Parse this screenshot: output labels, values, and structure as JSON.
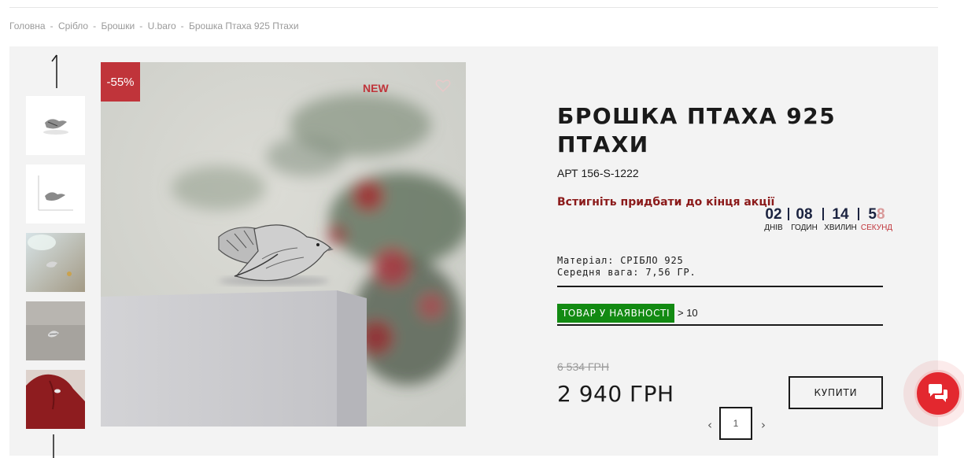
{
  "breadcrumb": [
    "Головна",
    "Срібло",
    "Брошки",
    "U.baro",
    "Брошка Птаха 925 Птахи"
  ],
  "breadcrumb_separator": "-",
  "badges": {
    "discount": "-55%",
    "new": "NEW"
  },
  "product": {
    "title": "БРОШКА ПТАХА 925 ПТАХИ",
    "sku": "АРТ 156-S-1222",
    "promo": "Встигніть придбати до кінця акції",
    "countdown": [
      {
        "value": "02",
        "label": "ДНІВ"
      },
      {
        "value": "08",
        "label": "ГОДИН"
      },
      {
        "value": "14",
        "label": "ХВИЛИН"
      },
      {
        "value_main": "5",
        "value_faded": "8",
        "label": "СЕКУНД"
      }
    ],
    "material": "Матеріал: СРІБЛО 925",
    "weight": "Середня вага: 7,56 ГР.",
    "stock_label": "ТОВАР У НАЯВНОСТІ",
    "stock_count": "> 10",
    "old_price": "6 534 ГРН",
    "price": "2 940 ГРН",
    "buy_label": "КУПИТИ",
    "quantity": "1"
  },
  "icons": {
    "prev": "‹",
    "next": "›",
    "wishlist": "heart-icon",
    "chat": "chat-bubbles-icon"
  },
  "colors": {
    "accent_red": "#c0343a",
    "promo_red": "#8b1a1a",
    "stock_green": "#128a12",
    "chat_red": "#e3282f"
  }
}
